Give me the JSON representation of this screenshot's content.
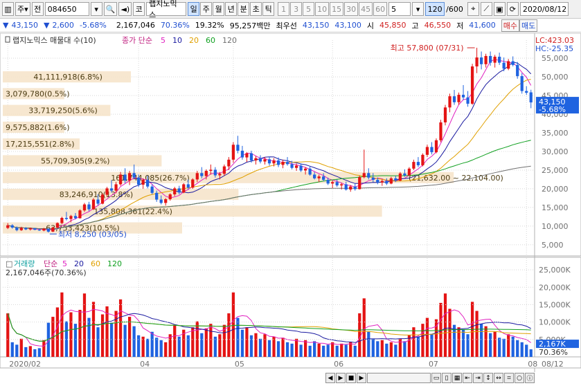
{
  "toolbar": {
    "mode": "주",
    "prev": "전",
    "code": "084650",
    "market_btn": "코",
    "name": "랩지노믹스",
    "periods": [
      "일",
      "주",
      "월",
      "년",
      "분",
      "초",
      "틱"
    ],
    "active_period": "일",
    "intervals": [
      "1",
      "3",
      "5",
      "10",
      "15",
      "30",
      "45",
      "60"
    ],
    "custom_interval": "5",
    "count": "120",
    "count_total": "/600",
    "date": "2020/08/12"
  },
  "quote": {
    "price": "43,150",
    "change": "2,600",
    "change_pct": "-5.68%",
    "volume": "2,167,046",
    "vol_ratio": "70.36%",
    "turnover": "19.32%",
    "amount": "95,257백만",
    "best_label": "최우선",
    "ask": "43,150",
    "bid": "43,100",
    "open_label": "시",
    "open": "45,850",
    "high_label": "고",
    "high": "46,550",
    "low_label": "저",
    "low": "41,600",
    "buy": "매수",
    "sell": "매도"
  },
  "chart_data": {
    "type": "candlestick",
    "title": "랩지노믹스 매물대 수(10)",
    "ma_label": "종가 단순",
    "ma_periods": [
      "5",
      "10",
      "20",
      "60",
      "120"
    ],
    "ma_colors": [
      "#e020c0",
      "#1a1aa0",
      "#e0a000",
      "#10a020",
      "#707070"
    ],
    "price_axis": [
      "55,000",
      "50,000",
      "45,000",
      "40,000",
      "35,000",
      "30,000",
      "25,000",
      "20,000",
      "15,000",
      "10,000",
      "5,000"
    ],
    "ylim": [
      2000,
      58000
    ],
    "lc_label": "LC:423.03",
    "hc_label": "HC:-25.35",
    "last_price": "43,150",
    "last_change": "-5.68%",
    "high_annot": "최고 57,800 (07/31)",
    "low_annot": "최저 8,250 (03/05)",
    "volume_profile": [
      {
        "label": "41,111,918(6.8%)",
        "price_low": 48500,
        "price_high": 51500,
        "frac": 0.25
      },
      {
        "label": "3,079,780(0.5%)",
        "price_low": 44000,
        "price_high": 47000,
        "frac": 0.12
      },
      {
        "label": "33,719,250(5.6%)",
        "price_low": 39500,
        "price_high": 42500,
        "frac": 0.21
      },
      {
        "label": "9,575,882(1.6%)",
        "price_low": 35000,
        "price_high": 38000,
        "frac": 0.12
      },
      {
        "label": "17,215,551(2.8%)",
        "price_low": 30500,
        "price_high": 33500,
        "frac": 0.15
      },
      {
        "label": "55,709,305(9.2%)",
        "price_low": 26000,
        "price_high": 29000,
        "frac": 0.31
      },
      {
        "label": "161,744,085(26.7%)",
        "price_low": 21500,
        "price_high": 24500,
        "frac": 0.88
      },
      {
        "label": "83,246,910(13.8%)",
        "price_low": 17000,
        "price_high": 20000,
        "frac": 0.46
      },
      {
        "label": "135,808,361(22.4%)",
        "price_low": 12500,
        "price_high": 15500,
        "frac": 0.74
      },
      {
        "label": "63,753,423(10.5%)",
        "price_low": 8000,
        "price_high": 11000,
        "frac": 0.35
      }
    ],
    "range_annot": "(21,632.00 ~ 22,104.00)",
    "volume_title": "거래량",
    "volume_ma_label": "단순",
    "volume_ma_periods": [
      "5",
      "20",
      "60",
      "120"
    ],
    "volume_value": "2,167,046주(70.36%)",
    "volume_axis": [
      "25,000K",
      "20,000K",
      "15,000K",
      "10,000K",
      "5,000K"
    ],
    "vol_ylim": [
      0,
      27000
    ],
    "last_volume": "2,167K",
    "last_vol_pct": "70.36%",
    "x_labels": [
      "2020/02",
      "04",
      "05",
      "06",
      "07",
      "08"
    ],
    "x_label_idx": [
      0,
      29,
      50,
      72,
      93,
      115
    ],
    "last_date": "08/12",
    "candles": [
      [
        9500,
        10800,
        9200,
        10200
      ],
      [
        10200,
        10500,
        9300,
        9600
      ],
      [
        9600,
        9900,
        8600,
        8900
      ],
      [
        8900,
        9800,
        8700,
        9500
      ],
      [
        9500,
        9700,
        8900,
        9100
      ],
      [
        9100,
        9600,
        8800,
        9400
      ],
      [
        9400,
        9500,
        8900,
        9000
      ],
      [
        9000,
        9300,
        8700,
        8800
      ],
      [
        8800,
        9500,
        8600,
        9300
      ],
      [
        9300,
        9400,
        8250,
        8500
      ],
      [
        8500,
        9800,
        8400,
        9600
      ],
      [
        9600,
        11000,
        9400,
        10800
      ],
      [
        10800,
        12500,
        10500,
        12200
      ],
      [
        12200,
        13800,
        11500,
        11900
      ],
      [
        11900,
        13000,
        11000,
        12700
      ],
      [
        12700,
        13500,
        11800,
        12100
      ],
      [
        12100,
        14500,
        12000,
        14200
      ],
      [
        14200,
        16200,
        13800,
        15800
      ],
      [
        15800,
        16500,
        14000,
        14500
      ],
      [
        14500,
        17500,
        14300,
        17100
      ],
      [
        17100,
        18500,
        15500,
        16000
      ],
      [
        16000,
        18800,
        15800,
        18400
      ],
      [
        18400,
        20500,
        17800,
        20100
      ],
      [
        20100,
        22300,
        19000,
        19500
      ],
      [
        19500,
        21800,
        18800,
        21200
      ],
      [
        21200,
        24500,
        20800,
        23800
      ],
      [
        23800,
        25500,
        21500,
        22200
      ],
      [
        22200,
        24800,
        21000,
        24200
      ],
      [
        24200,
        26500,
        22500,
        23000
      ],
      [
        23000,
        23800,
        20500,
        21100
      ],
      [
        21100,
        22800,
        20000,
        22400
      ],
      [
        22400,
        23500,
        20100,
        20600
      ],
      [
        20600,
        21200,
        18500,
        18900
      ],
      [
        18900,
        19500,
        16500,
        17100
      ],
      [
        17100,
        18200,
        15800,
        16200
      ],
      [
        16200,
        17500,
        15500,
        17200
      ],
      [
        17200,
        18800,
        16800,
        18500
      ],
      [
        18500,
        20500,
        18000,
        20100
      ],
      [
        20100,
        20800,
        18500,
        19000
      ],
      [
        19000,
        21500,
        18800,
        21200
      ],
      [
        21200,
        22500,
        19800,
        20300
      ],
      [
        20300,
        22800,
        20000,
        22500
      ],
      [
        22500,
        24800,
        21800,
        24200
      ],
      [
        24200,
        25800,
        22800,
        23400
      ],
      [
        23400,
        25200,
        22500,
        24800
      ],
      [
        24800,
        26500,
        23800,
        25100
      ],
      [
        25100,
        25800,
        23000,
        23600
      ],
      [
        23600,
        24500,
        22500,
        24000
      ],
      [
        24000,
        26500,
        23500,
        26000
      ],
      [
        26000,
        28500,
        25000,
        27800
      ],
      [
        27800,
        32500,
        27000,
        31800
      ],
      [
        31800,
        34200,
        29500,
        30200
      ],
      [
        30200,
        31500,
        27800,
        28400
      ],
      [
        28400,
        29800,
        27200,
        29500
      ],
      [
        29500,
        30200,
        27000,
        27600
      ],
      [
        27600,
        28800,
        26500,
        28200
      ],
      [
        28200,
        29000,
        26800,
        27300
      ],
      [
        27300,
        28500,
        26500,
        27900
      ],
      [
        27900,
        28600,
        26200,
        26800
      ],
      [
        26800,
        28200,
        26000,
        27600
      ],
      [
        27600,
        28400,
        25800,
        26400
      ],
      [
        26400,
        27800,
        25500,
        27200
      ],
      [
        27200,
        28500,
        26200,
        26600
      ],
      [
        26600,
        27500,
        25200,
        25600
      ],
      [
        25600,
        26800,
        24800,
        26200
      ],
      [
        26200,
        26800,
        24500,
        24900
      ],
      [
        24900,
        25800,
        23800,
        25400
      ],
      [
        25400,
        25900,
        23500,
        23800
      ],
      [
        23800,
        24500,
        22500,
        22800
      ],
      [
        22800,
        23800,
        21800,
        23300
      ],
      [
        23300,
        24200,
        22000,
        22400
      ],
      [
        22400,
        23000,
        21000,
        21400
      ],
      [
        21400,
        22200,
        20200,
        21800
      ],
      [
        21800,
        22500,
        20500,
        20900
      ],
      [
        20900,
        21600,
        19800,
        21200
      ],
      [
        21200,
        21900,
        19500,
        19800
      ],
      [
        19800,
        21000,
        19200,
        20600
      ],
      [
        20600,
        21500,
        19500,
        19900
      ],
      [
        19900,
        23500,
        19800,
        23100
      ],
      [
        23100,
        30500,
        22800,
        24200
      ],
      [
        24200,
        25500,
        22500,
        23000
      ],
      [
        23000,
        24200,
        21800,
        22400
      ],
      [
        22400,
        23000,
        21200,
        21700
      ],
      [
        21700,
        22500,
        20800,
        22100
      ],
      [
        22100,
        22800,
        21000,
        21400
      ],
      [
        21400,
        23200,
        21200,
        22800
      ],
      [
        22800,
        23500,
        21800,
        22200
      ],
      [
        22200,
        24500,
        22000,
        24100
      ],
      [
        24100,
        25200,
        23200,
        23600
      ],
      [
        23600,
        25800,
        23400,
        25400
      ],
      [
        25400,
        27800,
        25000,
        27200
      ],
      [
        27200,
        28500,
        25800,
        26300
      ],
      [
        26300,
        29500,
        26000,
        29100
      ],
      [
        29100,
        31800,
        28500,
        31200
      ],
      [
        31200,
        32500,
        29200,
        29800
      ],
      [
        29800,
        33500,
        29500,
        33000
      ],
      [
        33000,
        38500,
        32500,
        37800
      ],
      [
        37800,
        42500,
        37000,
        41800
      ],
      [
        41800,
        45500,
        40500,
        44800
      ],
      [
        44800,
        46500,
        42500,
        43200
      ],
      [
        43200,
        45800,
        42500,
        45200
      ],
      [
        45200,
        47800,
        43800,
        44500
      ],
      [
        44500,
        46200,
        42000,
        42800
      ],
      [
        42800,
        53500,
        42500,
        52800
      ],
      [
        52800,
        57800,
        51000,
        55200
      ],
      [
        55200,
        56800,
        52000,
        53400
      ],
      [
        53400,
        56200,
        52500,
        55600
      ],
      [
        55600,
        56800,
        53000,
        53800
      ],
      [
        53800,
        55900,
        52500,
        55400
      ],
      [
        55400,
        56500,
        53200,
        53800
      ],
      [
        53800,
        55200,
        51500,
        52200
      ],
      [
        52200,
        54800,
        51800,
        54200
      ],
      [
        54200,
        55500,
        52800,
        53200
      ],
      [
        53200,
        54000,
        49500,
        50200
      ],
      [
        50200,
        51000,
        45500,
        46200
      ],
      [
        46200,
        47500,
        45200,
        45750
      ],
      [
        45850,
        46550,
        41600,
        43150
      ]
    ],
    "volumes": [
      12500,
      4200,
      3500,
      5200,
      2800,
      3100,
      2200,
      2500,
      4800,
      9800,
      11500,
      14200,
      18500,
      10200,
      12800,
      9500,
      13500,
      18200,
      11200,
      15800,
      8500,
      12200,
      14500,
      9800,
      13200,
      16500,
      9200,
      11500,
      8800,
      6200,
      5800,
      5200,
      7200,
      5500,
      4800,
      4200,
      6500,
      9200,
      5800,
      7800,
      6200,
      8500,
      10200,
      6800,
      8200,
      9500,
      5800,
      6500,
      9200,
      12500,
      18500,
      11200,
      7800,
      8500,
      6200,
      6800,
      5200,
      6500,
      4800,
      5800,
      4500,
      5500,
      4200,
      3800,
      5200,
      3500,
      4800,
      3200,
      4500,
      3800,
      3200,
      3500,
      4200,
      3200,
      3800,
      3500,
      4200,
      3200,
      12500,
      16800,
      7200,
      5200,
      4500,
      4800,
      3800,
      4200,
      3500,
      5200,
      4500,
      6200,
      8500,
      5800,
      9500,
      11200,
      6500,
      10800,
      15500,
      18200,
      13800,
      9200,
      8500,
      7800,
      6500,
      15800,
      13200,
      9500,
      8800,
      6800,
      7200,
      5500,
      5200,
      6500,
      5800,
      4800,
      4200,
      3500,
      2167
    ]
  }
}
